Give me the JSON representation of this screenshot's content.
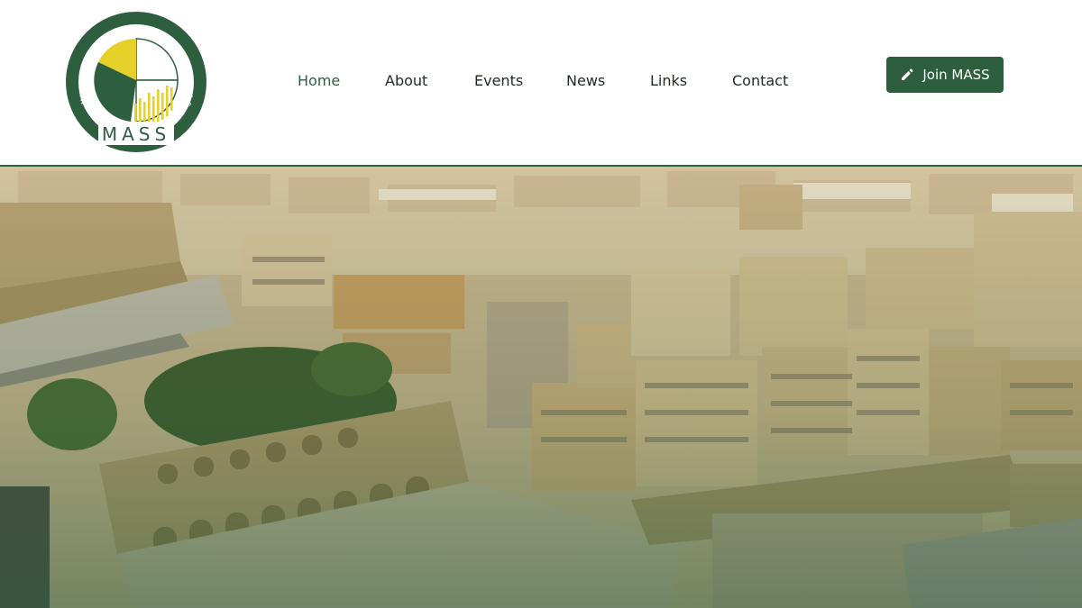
{
  "brand": {
    "logo_text": "MASS",
    "logo_ring_text": "MALTA ASSOCIATION OF MINORITY SHAREHOLDERS & RETAIL INVESTORS",
    "colors": {
      "primary": "#2d5e3e",
      "accent": "#e5d12a"
    }
  },
  "nav": {
    "items": [
      {
        "label": "Home",
        "active": true
      },
      {
        "label": "About"
      },
      {
        "label": "Events"
      },
      {
        "label": "News"
      },
      {
        "label": "Links"
      },
      {
        "label": "Contact"
      }
    ]
  },
  "cta": {
    "label": "Join MASS",
    "icon": "pencil-icon"
  },
  "hero": {
    "image": "aerial-view-of-valletta-city"
  }
}
